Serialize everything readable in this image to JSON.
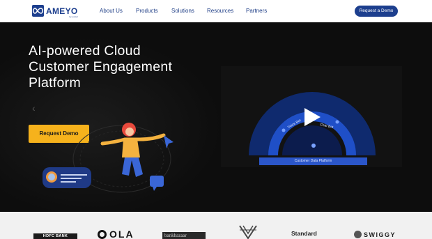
{
  "brand": {
    "name": "AMEYO",
    "tagline": "by exotel",
    "color": "#1d3f8e"
  },
  "nav": {
    "items": [
      "About Us",
      "Products",
      "Solutions",
      "Resources",
      "Partners"
    ],
    "demo_label": "Request a Demo"
  },
  "hero": {
    "headline": [
      "AI-powered Cloud",
      "Customer Engagement",
      "Platform"
    ],
    "cta_label": "Request Demo",
    "cta_color": "#f6b21c",
    "prev_icon": "chevron-left-icon",
    "next_icon": "chevron-right-icon"
  },
  "video": {
    "play_icon": "play-icon",
    "arc_labels": [
      "Voice Bot",
      "Chat Bot"
    ],
    "platform_label": "Customer Data Platform"
  },
  "clients": {
    "logos": [
      "HDFC BANK",
      "OLA",
      "bankbazaar",
      "V-mark",
      "Standard Chartered",
      "SWIGGY"
    ],
    "hdfc": "HDFC BANK",
    "ola": "OLA",
    "bankbazaar": "bankbazaar",
    "standard": "Standard",
    "swiggy": "SWIGGY"
  }
}
